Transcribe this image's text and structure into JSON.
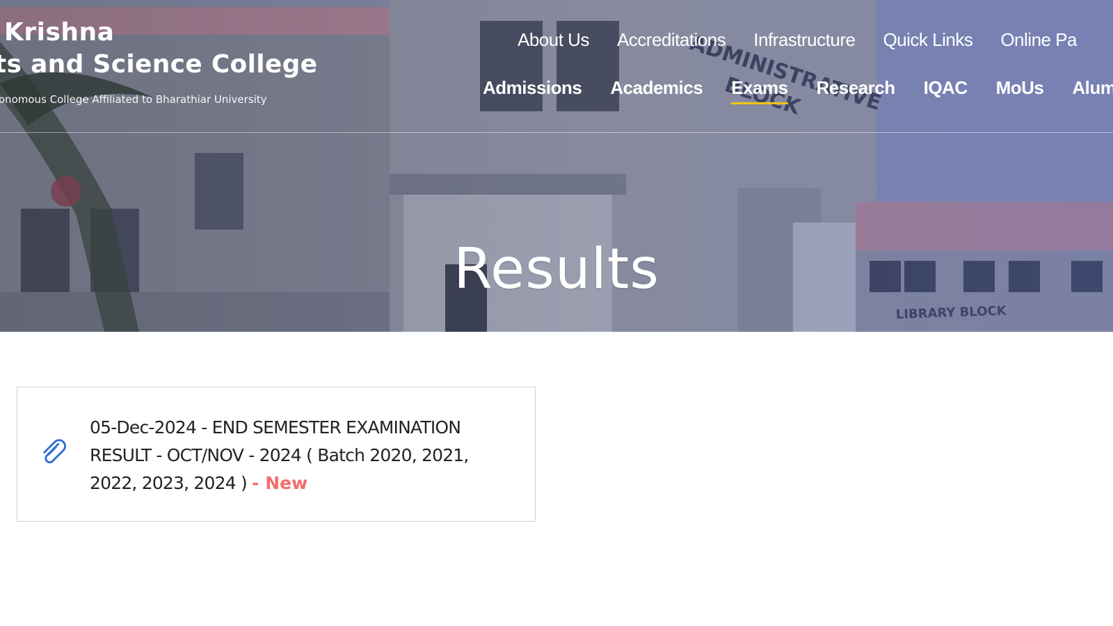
{
  "brand": {
    "line1": "Krishna",
    "line2": "ts and Science College",
    "tagline": "tonomous College Affiliated to Bharathiar University"
  },
  "nav_top": [
    {
      "label": "About Us"
    },
    {
      "label": "Accreditations"
    },
    {
      "label": "Infrastructure"
    },
    {
      "label": "Quick Links"
    },
    {
      "label": "Online Pa"
    }
  ],
  "nav_main": [
    {
      "label": "Admissions"
    },
    {
      "label": "Academics"
    },
    {
      "label": "Exams",
      "active": true
    },
    {
      "label": "Research"
    },
    {
      "label": "IQAC"
    },
    {
      "label": "MoUs"
    },
    {
      "label": "Alum"
    }
  ],
  "hero": {
    "title": "Results",
    "building_signs": [
      "ADMINISTRATIVE BLOCK",
      "LIBRARY BLOCK"
    ]
  },
  "results": [
    {
      "icon": "paperclip-icon",
      "text": "05-Dec-2024 - END SEMESTER EXAMINATION RESULT - OCT/NOV - 2024 ( Batch 2020, 2021, 2022, 2023, 2024 )",
      "badge": "- New"
    }
  ],
  "colors": {
    "active_underline": "#f0c419",
    "new_badge": "#f46d6d",
    "link_icon": "#2f6fd6"
  }
}
